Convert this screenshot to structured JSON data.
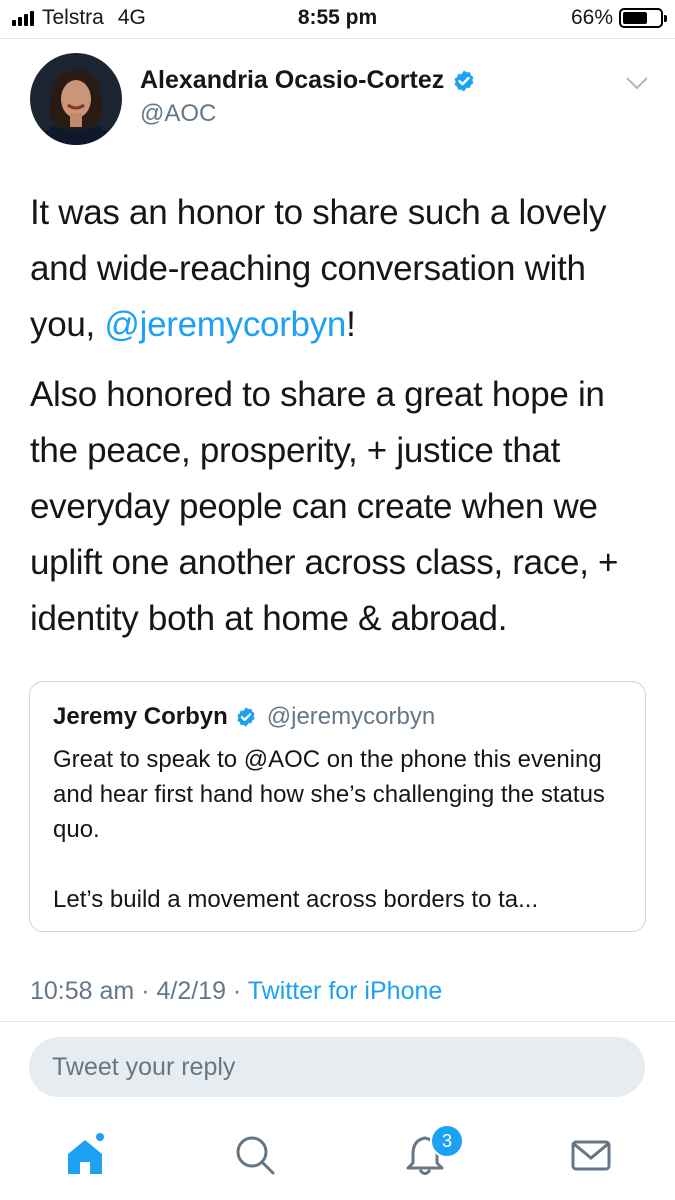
{
  "status_bar": {
    "carrier": "Telstra",
    "network": "4G",
    "time": "8:55 pm",
    "battery": "66%",
    "battery_level": 0.66
  },
  "tweet": {
    "author_name": "Alexandria Ocasio-Cortez",
    "author_handle": "@AOC",
    "para1_a": "It was an honor to share such a lovely and wide-reaching conversation with you, ",
    "para1_mention": "@jeremycorbyn",
    "para1_b": "!",
    "para2": "Also honored to share a great hope in the peace, prosperity, + justice that everyday people can create when we uplift one another across class, race, + identity both at home & abroad.",
    "time": "10:58 am",
    "sep1": " · ",
    "date": "4/2/19",
    "sep2": " · ",
    "source": "Twitter for iPhone"
  },
  "quote": {
    "name": "Jeremy Corbyn",
    "handle": "@jeremycorbyn",
    "text1": "Great to speak to @AOC on the phone this evening and hear first hand how she’s challenging the status quo.",
    "text2": "Let’s build a movement across borders to ta..."
  },
  "reply": {
    "placeholder": "Tweet your reply"
  },
  "tabbar": {
    "notifications_badge": "3",
    "icons": [
      "home-icon",
      "search-icon",
      "notifications-icon",
      "messages-icon"
    ]
  },
  "colors": {
    "accent": "#1da1f2",
    "text": "#14171a",
    "secondary": "#657786",
    "reply_bg": "#e6ecf0"
  }
}
